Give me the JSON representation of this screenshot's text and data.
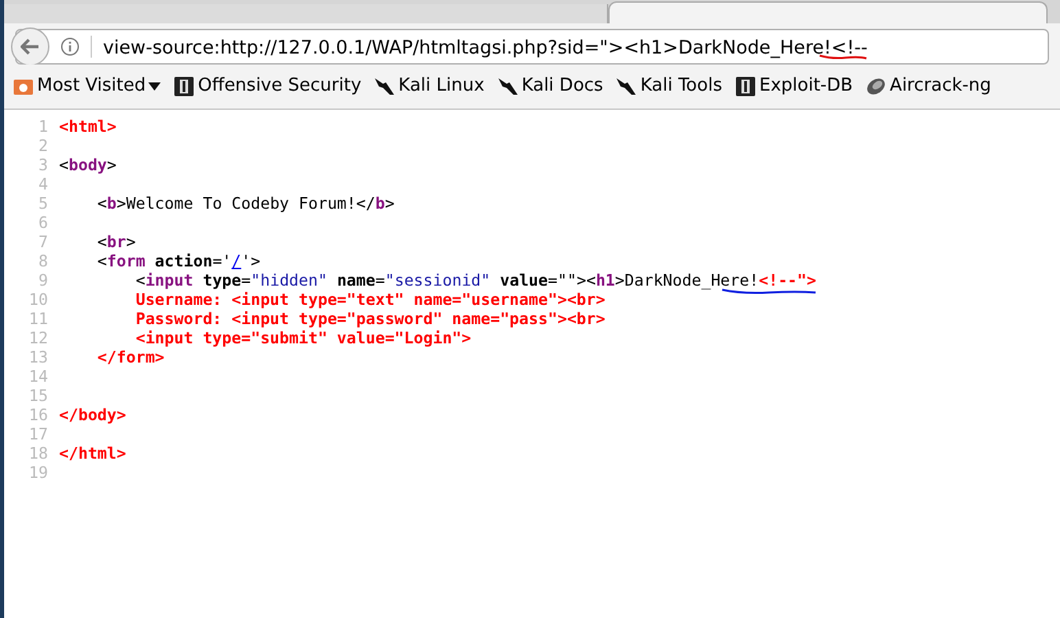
{
  "address_bar": {
    "url": "view-source:http://127.0.0.1/WAP/htmltagsi.php?sid=\"><h1>DarkNode_Here!<!--"
  },
  "bookmarks": [
    {
      "label": "Most Visited",
      "kind": "menu"
    },
    {
      "label": "Offensive Security",
      "kind": "site"
    },
    {
      "label": "Kali Linux",
      "kind": "dragon"
    },
    {
      "label": "Kali Docs",
      "kind": "dragon"
    },
    {
      "label": "Kali Tools",
      "kind": "dragon"
    },
    {
      "label": "Exploit-DB",
      "kind": "site"
    },
    {
      "label": "Aircrack-ng",
      "kind": "wave"
    }
  ],
  "source_lines": [
    {
      "number": "1",
      "segments": [
        {
          "text": "<html>",
          "kind": "error"
        }
      ]
    },
    {
      "number": "2"
    },
    {
      "number": "3",
      "segments": [
        {
          "text": "<",
          "kind": "plain"
        },
        {
          "text": "body",
          "kind": "tag"
        },
        {
          "text": ">",
          "kind": "plain"
        }
      ]
    },
    {
      "number": "4"
    },
    {
      "number": "5",
      "segments": [
        {
          "text": "    <",
          "kind": "plain"
        },
        {
          "text": "b",
          "kind": "tag"
        },
        {
          "text": ">Welcome To Codeby Forum!</",
          "kind": "plain"
        },
        {
          "text": "b",
          "kind": "tag"
        },
        {
          "text": ">",
          "kind": "plain"
        }
      ]
    },
    {
      "number": "6"
    },
    {
      "number": "7",
      "segments": [
        {
          "text": "    <",
          "kind": "plain"
        },
        {
          "text": "br",
          "kind": "tag"
        },
        {
          "text": ">",
          "kind": "plain"
        }
      ]
    },
    {
      "number": "8",
      "segments": [
        {
          "text": "    <",
          "kind": "plain"
        },
        {
          "text": "form",
          "kind": "tag"
        },
        {
          "text": " action",
          "kind": "attr"
        },
        {
          "text": "='",
          "kind": "plain"
        },
        {
          "text": "/",
          "kind": "link"
        },
        {
          "text": "'>",
          "kind": "plain"
        }
      ]
    },
    {
      "number": "9",
      "segments": [
        {
          "text": "        <",
          "kind": "plain"
        },
        {
          "text": "input",
          "kind": "tag"
        },
        {
          "text": " type",
          "kind": "attr"
        },
        {
          "text": "=",
          "kind": "plain"
        },
        {
          "text": "\"hidden\"",
          "kind": "value"
        },
        {
          "text": " name",
          "kind": "attr"
        },
        {
          "text": "=",
          "kind": "plain"
        },
        {
          "text": "\"sessionid\"",
          "kind": "value"
        },
        {
          "text": " value",
          "kind": "attr"
        },
        {
          "text": "=\"\"><",
          "kind": "plain"
        },
        {
          "text": "h1",
          "kind": "tag"
        },
        {
          "text": ">DarkNode_Here!",
          "kind": "plain"
        },
        {
          "text": "<!--\">",
          "kind": "error"
        }
      ]
    },
    {
      "number": "10",
      "segments": [
        {
          "text": "        Username: <input type=\"text\" name=\"username\"><br>",
          "kind": "error"
        }
      ]
    },
    {
      "number": "11",
      "segments": [
        {
          "text": "        Password: <input type=\"password\" name=\"pass\"><br>",
          "kind": "error"
        }
      ]
    },
    {
      "number": "12",
      "segments": [
        {
          "text": "        <input type=\"submit\" value=\"Login\">",
          "kind": "error"
        }
      ]
    },
    {
      "number": "13",
      "segments": [
        {
          "text": "    </form>",
          "kind": "error"
        }
      ]
    },
    {
      "number": "14"
    },
    {
      "number": "15"
    },
    {
      "number": "16",
      "segments": [
        {
          "text": "</body>",
          "kind": "error"
        }
      ]
    },
    {
      "number": "17"
    },
    {
      "number": "18",
      "segments": [
        {
          "text": "</html>",
          "kind": "error"
        }
      ]
    },
    {
      "number": "19"
    }
  ]
}
